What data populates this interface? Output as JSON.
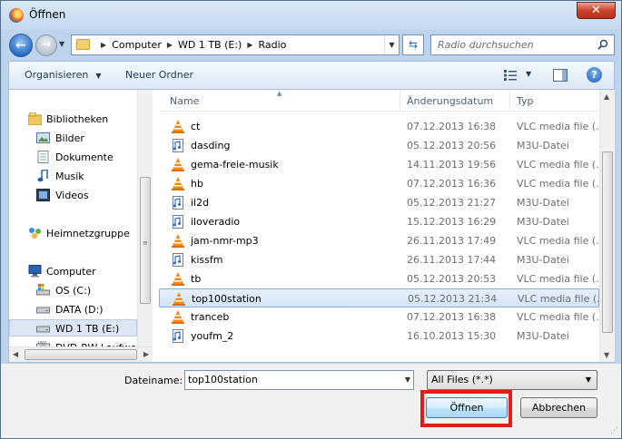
{
  "window": {
    "title": "Öffnen",
    "close_glyph": "✕"
  },
  "nav": {
    "breadcrumb": [
      "Computer",
      "WD 1 TB (E:)",
      "Radio"
    ],
    "search_placeholder": "Radio durchsuchen"
  },
  "toolbar": {
    "organize": "Organisieren",
    "new_folder": "Neuer Ordner",
    "help": "?"
  },
  "sidebar": {
    "items": [
      {
        "label": "Bibliotheken",
        "icon": "libraries-icon"
      },
      {
        "label": "Bilder",
        "icon": "pictures-icon"
      },
      {
        "label": "Dokumente",
        "icon": "documents-icon"
      },
      {
        "label": "Musik",
        "icon": "music-icon"
      },
      {
        "label": "Videos",
        "icon": "videos-icon"
      },
      {
        "label": "Heimnetzgruppe",
        "icon": "homegroup-icon"
      },
      {
        "label": "Computer",
        "icon": "computer-icon"
      },
      {
        "label": "OS (C:)",
        "icon": "drive-c-icon"
      },
      {
        "label": "DATA (D:)",
        "icon": "drive-icon"
      },
      {
        "label": "WD 1 TB (E:)",
        "icon": "drive-icon",
        "selected": true
      },
      {
        "label": "DVD-RW-Laufwe",
        "icon": "dvd-drive-icon"
      }
    ]
  },
  "columns": {
    "name": "Name",
    "date": "Änderungsdatum",
    "type": "Typ"
  },
  "files": [
    {
      "name": "ct",
      "date": "07.12.2013 16:38",
      "type": "VLC media file (.p",
      "icon": "vlc-file-icon"
    },
    {
      "name": "dasding",
      "date": "05.12.2013 20:56",
      "type": "M3U-Datei",
      "icon": "m3u-file-icon"
    },
    {
      "name": "gema-freie-musik",
      "date": "14.11.2013 19:56",
      "type": "VLC media file (.p",
      "icon": "vlc-file-icon"
    },
    {
      "name": "hb",
      "date": "07.12.2013 16:36",
      "type": "VLC media file (.p",
      "icon": "vlc-file-icon"
    },
    {
      "name": "il2d",
      "date": "05.12.2013 21:27",
      "type": "M3U-Datei",
      "icon": "m3u-file-icon"
    },
    {
      "name": "iloveradio",
      "date": "15.12.2013 16:29",
      "type": "M3U-Datei",
      "icon": "m3u-file-icon"
    },
    {
      "name": "jam-nmr-mp3",
      "date": "26.11.2013 17:49",
      "type": "VLC media file (.p",
      "icon": "vlc-file-icon"
    },
    {
      "name": "kissfm",
      "date": "26.11.2013 17:44",
      "type": "M3U-Datei",
      "icon": "m3u-file-icon"
    },
    {
      "name": "tb",
      "date": "05.12.2013 20:53",
      "type": "VLC media file (.p",
      "icon": "vlc-file-icon"
    },
    {
      "name": "top100station",
      "date": "05.12.2013 21:34",
      "type": "VLC media file (.p",
      "icon": "vlc-file-icon",
      "selected": true
    },
    {
      "name": "tranceb",
      "date": "07.12.2013 16:38",
      "type": "VLC media file (.p",
      "icon": "vlc-file-icon"
    },
    {
      "name": "youfm_2",
      "date": "16.10.2013 15:30",
      "type": "M3U-Datei",
      "icon": "m3u-file-icon"
    }
  ],
  "bottom": {
    "filename_label": "Dateiname:",
    "filename_value": "top100station",
    "filter_value": "All Files (*.*)",
    "open_label": "Öffnen",
    "cancel_label": "Abbrechen"
  },
  "colors": {
    "highlight": "#e41b1b",
    "selection": "#d2e4f8",
    "vlc_orange": "#f28a12"
  }
}
